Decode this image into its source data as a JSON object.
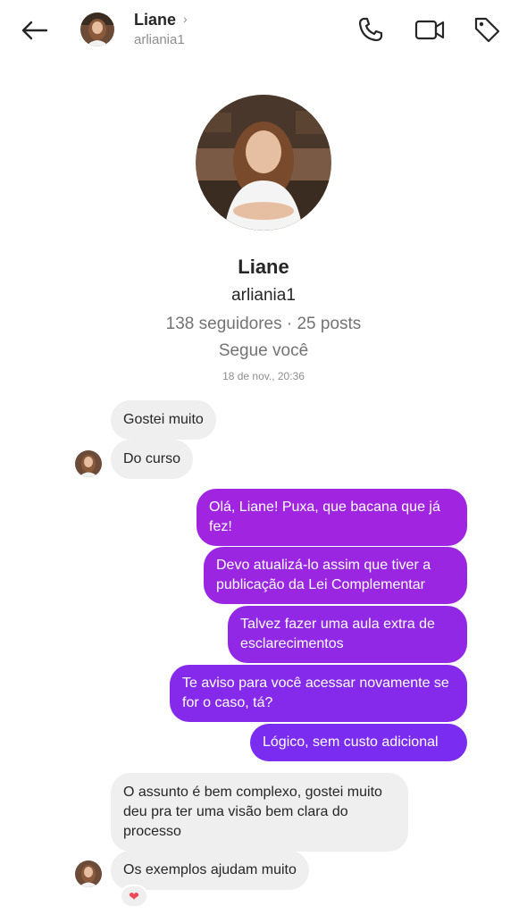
{
  "header": {
    "name": "Liane",
    "chevron": "›",
    "username": "arliania1",
    "icons": [
      "back-arrow-icon",
      "phone-icon",
      "video-camera-icon",
      "tag-icon"
    ]
  },
  "profile": {
    "name": "Liane",
    "username": "arliania1",
    "stats": "138 seguidores · 25 posts",
    "follows_you": "Segue você",
    "timestamp": "18 de nov., 20:36"
  },
  "messages": [
    {
      "from": "them",
      "text": "Gostei muito"
    },
    {
      "from": "them",
      "text": "Do curso"
    },
    {
      "from": "me",
      "text": "Olá, Liane! Puxa, que bacana que já fez!"
    },
    {
      "from": "me",
      "text": "Devo atualizá-lo assim que tiver a publicação da Lei Complementar"
    },
    {
      "from": "me",
      "text": "Talvez fazer uma aula extra de esclarecimentos"
    },
    {
      "from": "me",
      "text": "Te aviso para você acessar novamente se for o caso, tá?"
    },
    {
      "from": "me",
      "text": "Lógico, sem custo adicional"
    },
    {
      "from": "them",
      "text": "O assunto é bem complexo, gostei muito deu pra ter uma visão bem clara do processo"
    },
    {
      "from": "them",
      "text": "Os exemplos ajudam muito"
    }
  ],
  "reaction": "❤",
  "colors": {
    "outgoing_top": "#a024e0",
    "outgoing_bottom": "#7a2cf0",
    "incoming": "#efefef"
  }
}
